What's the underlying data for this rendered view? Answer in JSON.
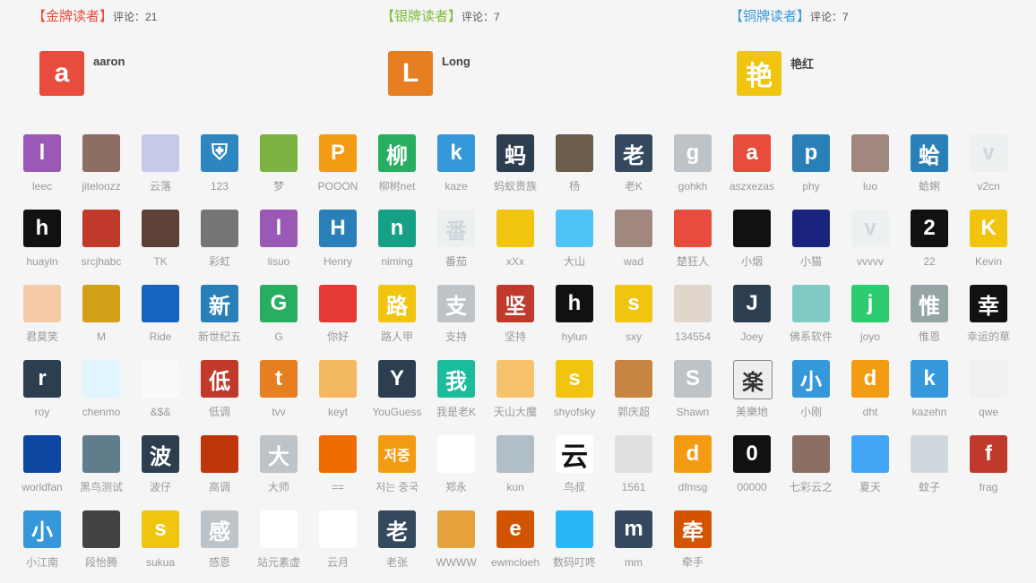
{
  "top_readers": [
    {
      "rank_label": "【金牌读者】",
      "comments_prefix": "评论：",
      "comments": "21",
      "avatar": "a",
      "name": "aaron",
      "label_color": "#e74c3c",
      "avatar_color": "#e74c3c"
    },
    {
      "rank_label": "【银牌读者】",
      "comments_prefix": "评论：",
      "comments": "7",
      "avatar": "L",
      "name": "Long",
      "label_color": "#7cbb3a",
      "avatar_color": "#e67e22"
    },
    {
      "rank_label": "【铜牌读者】",
      "comments_prefix": "评论：",
      "comments": "7",
      "avatar": "艳",
      "name": "艳红",
      "label_color": "#3a9ad9",
      "avatar_color": "#f1c40f"
    }
  ],
  "visitors": [
    {
      "name": "leec",
      "avatar": "l",
      "color": "#9b59b6"
    },
    {
      "name": "jiteloozz",
      "avatar": "",
      "color": "#8d6e63"
    },
    {
      "name": "云落",
      "avatar": "",
      "color": "#c5cae9"
    },
    {
      "name": "123",
      "avatar": "⛨",
      "color": "#2e86c1"
    },
    {
      "name": "梦",
      "avatar": "",
      "color": "#7cb342"
    },
    {
      "name": "POOON",
      "avatar": "P",
      "color": "#f39c12"
    },
    {
      "name": "柳树net",
      "avatar": "柳",
      "color": "#27ae60"
    },
    {
      "name": "kaze",
      "avatar": "k",
      "color": "#3498db"
    },
    {
      "name": "蚂蚁贵族",
      "avatar": "蚂",
      "color": "#2c3e50"
    },
    {
      "name": "杨",
      "avatar": "",
      "color": "#6d5d4b"
    },
    {
      "name": "老K",
      "avatar": "老",
      "color": "#34495e"
    },
    {
      "name": "gohkh",
      "avatar": "g",
      "color": "#bdc3c7"
    },
    {
      "name": "aszxezas",
      "avatar": "a",
      "color": "#e74c3c"
    },
    {
      "name": "phy",
      "avatar": "p",
      "color": "#2980b9"
    },
    {
      "name": "luo",
      "avatar": "",
      "color": "#a1887f"
    },
    {
      "name": "蛤蜊",
      "avatar": "蛤",
      "color": "#2980b9"
    },
    {
      "name": "v2cn",
      "avatar": "v",
      "color": "#ecf0f1"
    },
    {
      "name": "huayin",
      "avatar": "h",
      "color": "#111111"
    },
    {
      "name": "srcjhabc",
      "avatar": "",
      "color": "#c0392b"
    },
    {
      "name": "TK",
      "avatar": "",
      "color": "#5d4037"
    },
    {
      "name": "彩虹",
      "avatar": "",
      "color": "#757575"
    },
    {
      "name": "lisuo",
      "avatar": "l",
      "color": "#9b59b6"
    },
    {
      "name": "Henry",
      "avatar": "H",
      "color": "#2980b9"
    },
    {
      "name": "niming",
      "avatar": "n",
      "color": "#16a085"
    },
    {
      "name": "番茄",
      "avatar": "番",
      "color": "#ecf0f1"
    },
    {
      "name": "xXx",
      "avatar": "",
      "color": "#f1c40f"
    },
    {
      "name": "大山",
      "avatar": "",
      "color": "#4fc3f7"
    },
    {
      "name": "wad",
      "avatar": "",
      "color": "#a1887f"
    },
    {
      "name": "楚狂人",
      "avatar": "",
      "color": "#e74c3c"
    },
    {
      "name": "小烟",
      "avatar": "",
      "color": "#111111"
    },
    {
      "name": "小猫",
      "avatar": "",
      "color": "#1a237e"
    },
    {
      "name": "vvvvv",
      "avatar": "v",
      "color": "#ecf0f1"
    },
    {
      "name": "22",
      "avatar": "2",
      "color": "#111111"
    },
    {
      "name": "Kevin",
      "avatar": "K",
      "color": "#f1c40f"
    },
    {
      "name": "君莫笑",
      "avatar": "",
      "color": "#f5cba7"
    },
    {
      "name": "M",
      "avatar": "",
      "color": "#d4a017"
    },
    {
      "name": "Ride",
      "avatar": "",
      "color": "#1565c0"
    },
    {
      "name": "新世纪五",
      "avatar": "新",
      "color": "#2980b9"
    },
    {
      "name": "G",
      "avatar": "G",
      "color": "#27ae60"
    },
    {
      "name": "你好",
      "avatar": "",
      "color": "#e53935"
    },
    {
      "name": "路人甲",
      "avatar": "路",
      "color": "#f1c40f"
    },
    {
      "name": "支持",
      "avatar": "支",
      "color": "#bdc3c7"
    },
    {
      "name": "坚持",
      "avatar": "坚",
      "color": "#c0392b"
    },
    {
      "name": "hylun",
      "avatar": "h",
      "color": "#111111"
    },
    {
      "name": "sxy",
      "avatar": "s",
      "color": "#f1c40f"
    },
    {
      "name": "134554",
      "avatar": "",
      "color": "#e0d6cc"
    },
    {
      "name": "Joey",
      "avatar": "J",
      "color": "#2c3e50"
    },
    {
      "name": "佛系软件",
      "avatar": "",
      "color": "#80cbc4"
    },
    {
      "name": "joyo",
      "avatar": "j",
      "color": "#2ecc71"
    },
    {
      "name": "惟恩",
      "avatar": "惟",
      "color": "#95a5a6"
    },
    {
      "name": "幸运的草",
      "avatar": "幸",
      "color": "#111111"
    },
    {
      "name": "roy",
      "avatar": "r",
      "color": "#2c3e50"
    },
    {
      "name": "chenmo",
      "avatar": "",
      "color": "#e1f5fe"
    },
    {
      "name": "&$&",
      "avatar": "",
      "color": "#fafafa"
    },
    {
      "name": "低调",
      "avatar": "低",
      "color": "#c0392b"
    },
    {
      "name": "tvv",
      "avatar": "t",
      "color": "#e67e22"
    },
    {
      "name": "keyt",
      "avatar": "",
      "color": "#f4b860"
    },
    {
      "name": "YouGuess",
      "avatar": "Y",
      "color": "#2c3e50"
    },
    {
      "name": "我是老K",
      "avatar": "我",
      "color": "#1abc9c"
    },
    {
      "name": "天山大魔",
      "avatar": "",
      "color": "#f6c26b"
    },
    {
      "name": "shyofsky",
      "avatar": "s",
      "color": "#f1c40f"
    },
    {
      "name": "郭庆超",
      "avatar": "",
      "color": "#c68642"
    },
    {
      "name": "Shawn",
      "avatar": "S",
      "color": "#bdc3c7"
    },
    {
      "name": "美樂地",
      "avatar": "楽",
      "color": "#eeeeee"
    },
    {
      "name": "小刚",
      "avatar": "小",
      "color": "#3498db"
    },
    {
      "name": "dht",
      "avatar": "d",
      "color": "#f39c12"
    },
    {
      "name": "kazehn",
      "avatar": "k",
      "color": "#3498db"
    },
    {
      "name": "qwe",
      "avatar": "",
      "color": "#f0f0f0"
    },
    {
      "name": "worldfan",
      "avatar": "",
      "color": "#0d47a1"
    },
    {
      "name": "黑鸟测试",
      "avatar": "",
      "color": "#607d8b"
    },
    {
      "name": "波仔",
      "avatar": "波",
      "color": "#2c3e50"
    },
    {
      "name": "高调",
      "avatar": "",
      "color": "#bf360c"
    },
    {
      "name": "大师",
      "avatar": "大",
      "color": "#bdc3c7"
    },
    {
      "name": "==",
      "avatar": "",
      "color": "#ef6c00"
    },
    {
      "name": "저는 중국",
      "avatar": "저중",
      "color": "#f39c12"
    },
    {
      "name": "郑永",
      "avatar": "",
      "color": "#ffffff"
    },
    {
      "name": "kun",
      "avatar": "",
      "color": "#b0bec5"
    },
    {
      "name": "鸟叔",
      "avatar": "云",
      "color": "#ffffff"
    },
    {
      "name": "1561",
      "avatar": "",
      "color": "#e0e0e0"
    },
    {
      "name": "dfmsg",
      "avatar": "d",
      "color": "#f39c12"
    },
    {
      "name": "00000",
      "avatar": "0",
      "color": "#111111"
    },
    {
      "name": "七彩云之",
      "avatar": "",
      "color": "#8d6e63"
    },
    {
      "name": "夏天",
      "avatar": "",
      "color": "#42a5f5"
    },
    {
      "name": "蚊子",
      "avatar": "",
      "color": "#cfd8dc"
    },
    {
      "name": "frag",
      "avatar": "f",
      "color": "#c0392b"
    },
    {
      "name": "小江南",
      "avatar": "小",
      "color": "#3498db"
    },
    {
      "name": "段怡腾",
      "avatar": "",
      "color": "#424242"
    },
    {
      "name": "sukua",
      "avatar": "s",
      "color": "#f1c40f"
    },
    {
      "name": "感恩",
      "avatar": "感",
      "color": "#bdc3c7"
    },
    {
      "name": "站元素虚",
      "avatar": "",
      "color": "#ffffff"
    },
    {
      "name": "云月",
      "avatar": "",
      "color": "#ffffff"
    },
    {
      "name": "老张",
      "avatar": "老",
      "color": "#34495e"
    },
    {
      "name": "WWWW",
      "avatar": "",
      "color": "#e6a23c"
    },
    {
      "name": "ewmcloeh",
      "avatar": "e",
      "color": "#d35400"
    },
    {
      "name": "数码叮咚",
      "avatar": "",
      "color": "#29b6f6"
    },
    {
      "name": "mm",
      "avatar": "m",
      "color": "#34495e"
    },
    {
      "name": "牵手",
      "avatar": "牵",
      "color": "#d35400"
    }
  ]
}
